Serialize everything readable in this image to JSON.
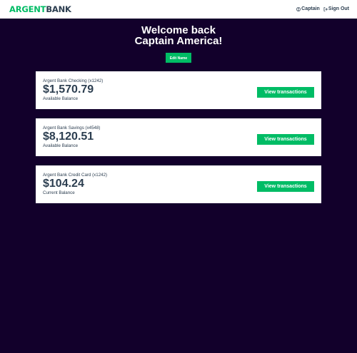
{
  "nav": {
    "logo_part1": "ARGENT",
    "logo_part2": "BANK",
    "user_label": "Captain",
    "signout_label": "Sign Out"
  },
  "hero": {
    "line1": "Welcome back",
    "line2": "Captain America!",
    "edit_label": "Edit Name"
  },
  "accounts": [
    {
      "title": "Argent Bank Checking (x1242)",
      "amount": "$1,570.79",
      "desc": "Available Balance",
      "button": "View transactions"
    },
    {
      "title": "Argent Bank Savings (x4548)",
      "amount": "$8,120.51",
      "desc": "Available Balance",
      "button": "View transactions"
    },
    {
      "title": "Argent Bank Credit Card (x1242)",
      "amount": "$104.24",
      "desc": "Current Balance",
      "button": "View transactions"
    }
  ],
  "colors": {
    "accent": "#00bc65",
    "background": "#12002b",
    "text": "#2c3e50"
  },
  "icons": {
    "user": "user-circle-icon",
    "signout": "sign-out-icon"
  }
}
